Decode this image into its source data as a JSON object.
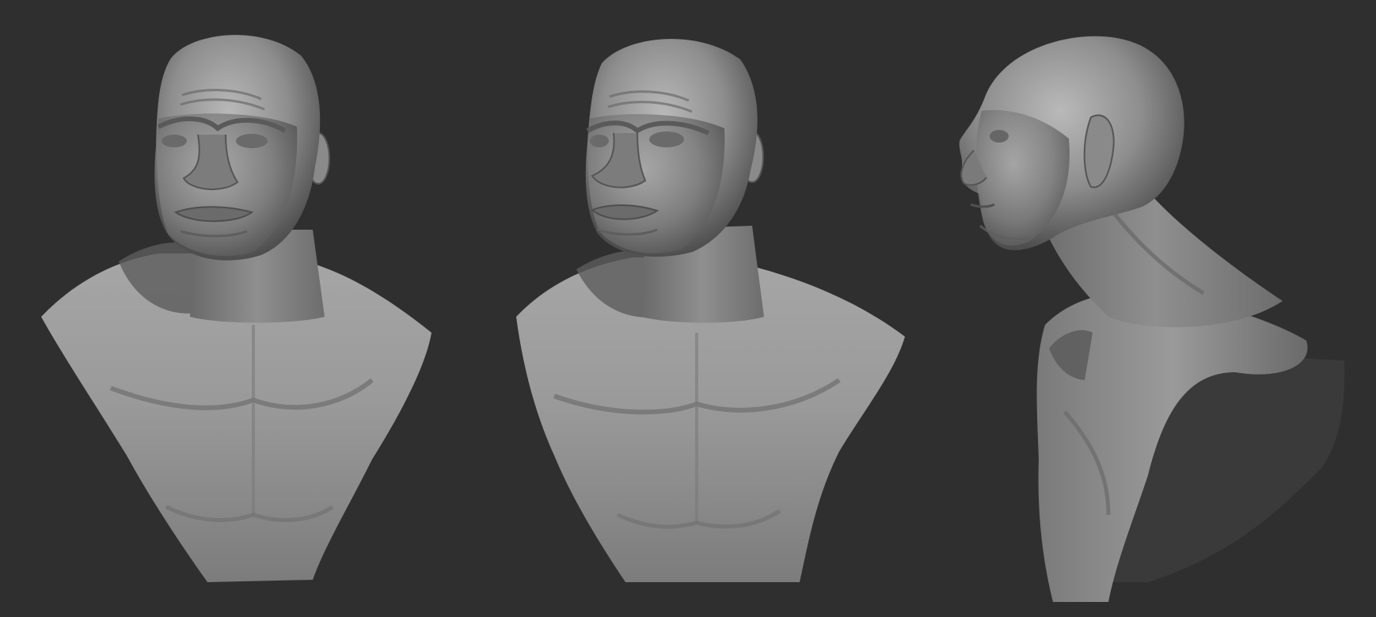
{
  "scene": {
    "background_color": "#2f2f2f",
    "clay_color": "#8c8c8c",
    "views": [
      {
        "name": "bust-three-quarter-front"
      },
      {
        "name": "bust-three-quarter-left"
      },
      {
        "name": "bust-profile-left"
      }
    ]
  }
}
